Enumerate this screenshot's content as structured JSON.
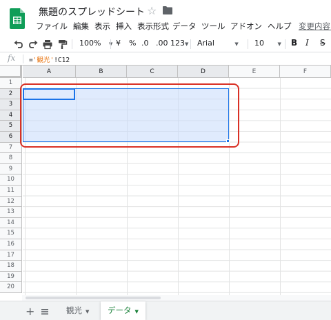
{
  "header": {
    "doc_title": "無題のスプレッドシート",
    "star_icon": "☆",
    "menu": [
      "ファイル",
      "編集",
      "表示",
      "挿入",
      "表示形式",
      "データ",
      "ツール",
      "アドオン",
      "ヘルプ"
    ],
    "changes_link": "変更内容を"
  },
  "toolbar": {
    "zoom": "100%",
    "currency": "¥",
    "percent": "%",
    "decrease_decimal": ".0",
    "increase_decimal": ".00",
    "more_formats": "123",
    "font": "Arial",
    "font_size": "10",
    "bold": "B",
    "italic": "I",
    "strikethrough": "S"
  },
  "formula_bar": {
    "fx": "fx",
    "prefix": "=",
    "sheet_ref": "'観光'",
    "cell_ref": "!C12"
  },
  "grid": {
    "columns": [
      "A",
      "B",
      "C",
      "D",
      "E",
      "F"
    ],
    "rows": [
      "1",
      "2",
      "3",
      "4",
      "5",
      "6",
      "7",
      "8",
      "9",
      "10",
      "11",
      "12",
      "13",
      "14",
      "15",
      "16",
      "17",
      "18",
      "19",
      "20"
    ],
    "selection": "A2:D6",
    "active_cell": "A2"
  },
  "sheets": {
    "add_label": "+",
    "tabs": [
      {
        "label": "観光",
        "active": false
      },
      {
        "label": "データ",
        "active": true
      }
    ],
    "caret": "▼"
  },
  "colors": {
    "accent": "#1a73e8",
    "selection_fill": "#c6dafc",
    "annotation": "#d93025",
    "active_tab": "#188038",
    "logo": "#0f9d58"
  }
}
